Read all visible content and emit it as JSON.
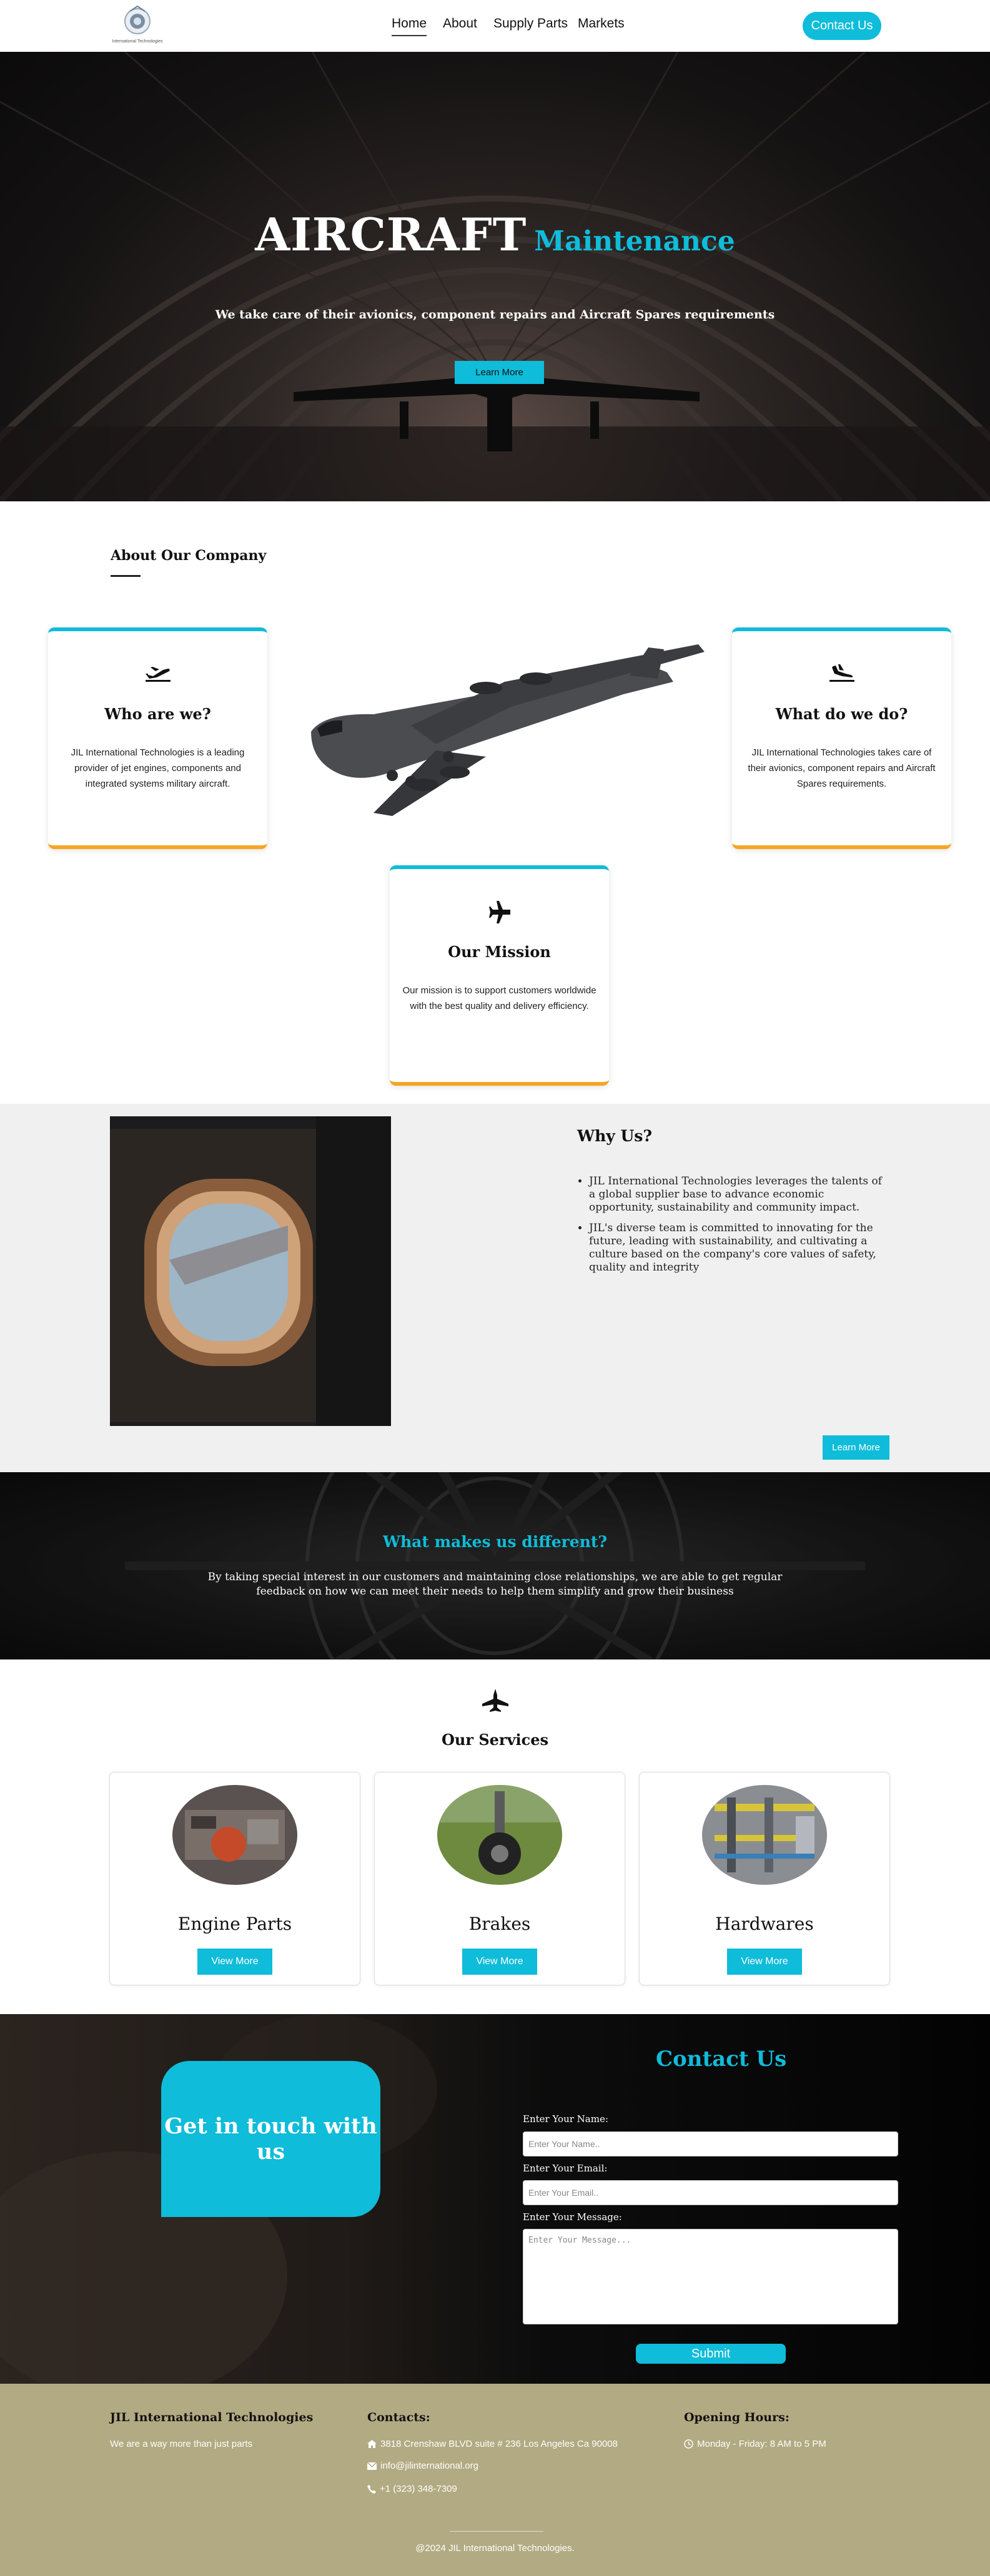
{
  "header": {
    "logo_text": "International Technologies",
    "nav": [
      "Home",
      "About",
      "Supply Parts",
      "Markets"
    ],
    "contact_button": "Contact Us"
  },
  "hero": {
    "title_main": "AIRCRAFT",
    "title_accent": "Maintenance",
    "subtitle": "We take care of their avionics, component repairs and Aircraft Spares requirements",
    "button": "Learn More"
  },
  "about": {
    "title": "About Our Company",
    "cards": [
      {
        "icon": "airplane-takeoff-icon",
        "title": "Who are we?",
        "text": "JIL International Technologies is a leading provider of jet engines, components and integrated systems military aircraft."
      },
      {
        "icon": "airplane-landing-icon",
        "title": "What do we do?",
        "text": "JIL International Technologies takes care of their avionics, component repairs and Aircraft Spares requirements."
      },
      {
        "icon": "airplane-icon",
        "title": "Our Mission",
        "text": "Our mission is to support customers worldwide with the best quality and delivery efficiency."
      }
    ]
  },
  "why": {
    "title": "Why Us?",
    "points": [
      "JIL International Technologies leverages the talents of a global supplier base to advance economic opportunity, sustainability and community impact.",
      "JIL's diverse team is committed to innovating for the future, leading with sustainability, and cultivating a culture based on the company's core values of safety, quality and integrity"
    ],
    "button": "Learn More"
  },
  "different": {
    "title": "What makes us different?",
    "text": "By taking special interest in our customers and maintaining close relationships, we are able to get regular feedback on how we can meet their needs to help them simplify and grow their business"
  },
  "services": {
    "title": "Our Services",
    "items": [
      {
        "name": "Engine Parts",
        "button": "View More"
      },
      {
        "name": "Brakes",
        "button": "View More"
      },
      {
        "name": "Hardwares",
        "button": "View More"
      }
    ]
  },
  "contact": {
    "title": "Contact Us",
    "tagline": "Get in touch with us",
    "name_label": "Enter Your Name:",
    "name_placeholder": "Enter Your Name..",
    "email_label": "Enter Your Email:",
    "email_placeholder": "Enter Your Email..",
    "message_label": "Enter Your Message:",
    "message_placeholder": "Enter Your Message...",
    "submit": "Submit"
  },
  "footer": {
    "company": "JIL International Technologies",
    "tagline": "We are a way more than just parts",
    "contacts_title": "Contacts:",
    "address": "3818 Crenshaw BLVD suite # 236 Los Angeles Ca 90008",
    "email": "info@jilinternational.org",
    "phone": "+1 (323) 348-7309",
    "hours_title": "Opening Hours:",
    "hours": "Monday - Friday: 8 AM to 5 PM",
    "copyright": "@2024 JIL International Technologies."
  },
  "colors": {
    "accent": "#0fbcd9",
    "card_bottom": "#f5a623",
    "footer_bg": "#b2aa82",
    "why_bg": "#f0f0f0"
  }
}
